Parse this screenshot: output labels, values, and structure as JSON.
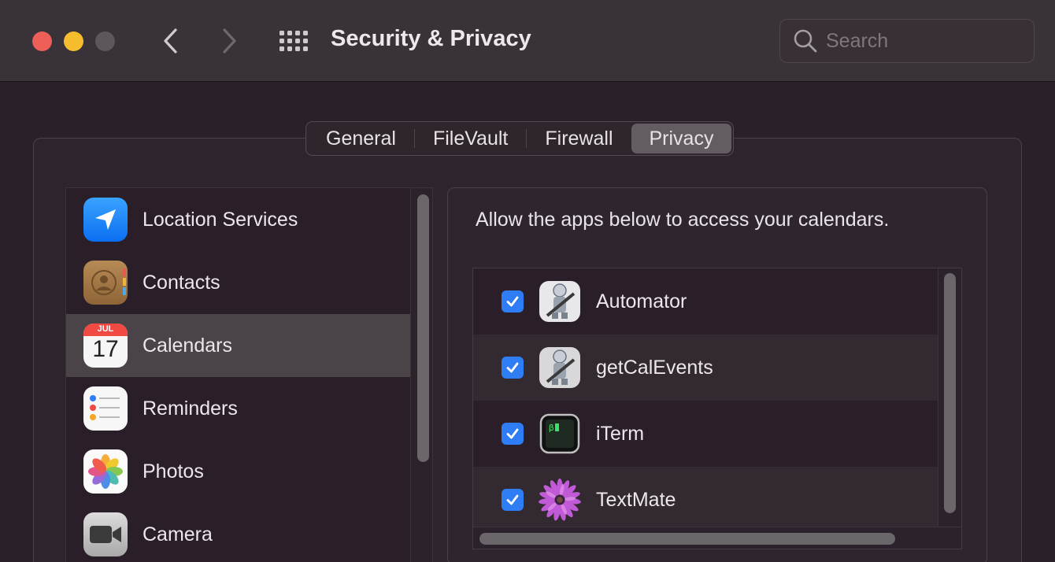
{
  "window": {
    "title": "Security & Privacy",
    "search_placeholder": "Search"
  },
  "tabs": [
    {
      "label": "General",
      "selected": false
    },
    {
      "label": "FileVault",
      "selected": false
    },
    {
      "label": "Firewall",
      "selected": false
    },
    {
      "label": "Privacy",
      "selected": true
    }
  ],
  "sidebar": {
    "items": [
      {
        "label": "Location Services",
        "icon": "location-arrow-icon",
        "selected": false
      },
      {
        "label": "Contacts",
        "icon": "contacts-icon",
        "selected": false
      },
      {
        "label": "Calendars",
        "icon": "calendar-icon",
        "selected": true,
        "calendar_month": "JUL",
        "calendar_day": "17"
      },
      {
        "label": "Reminders",
        "icon": "reminders-icon",
        "selected": false
      },
      {
        "label": "Photos",
        "icon": "photos-icon",
        "selected": false
      },
      {
        "label": "Camera",
        "icon": "camera-icon",
        "selected": false
      }
    ]
  },
  "panel": {
    "description": "Allow the apps below to access your calendars.",
    "apps": [
      {
        "label": "Automator",
        "icon": "automator-icon",
        "checked": true
      },
      {
        "label": "getCalEvents",
        "icon": "automator-icon",
        "checked": true
      },
      {
        "label": "iTerm",
        "icon": "terminal-icon",
        "checked": true
      },
      {
        "label": "TextMate",
        "icon": "textmate-flower-icon",
        "checked": true
      }
    ]
  },
  "colors": {
    "accent": "#2f7df5",
    "close": "#ee5f57",
    "minimize": "#f5bd2d",
    "selected_row": "#4a4449"
  }
}
